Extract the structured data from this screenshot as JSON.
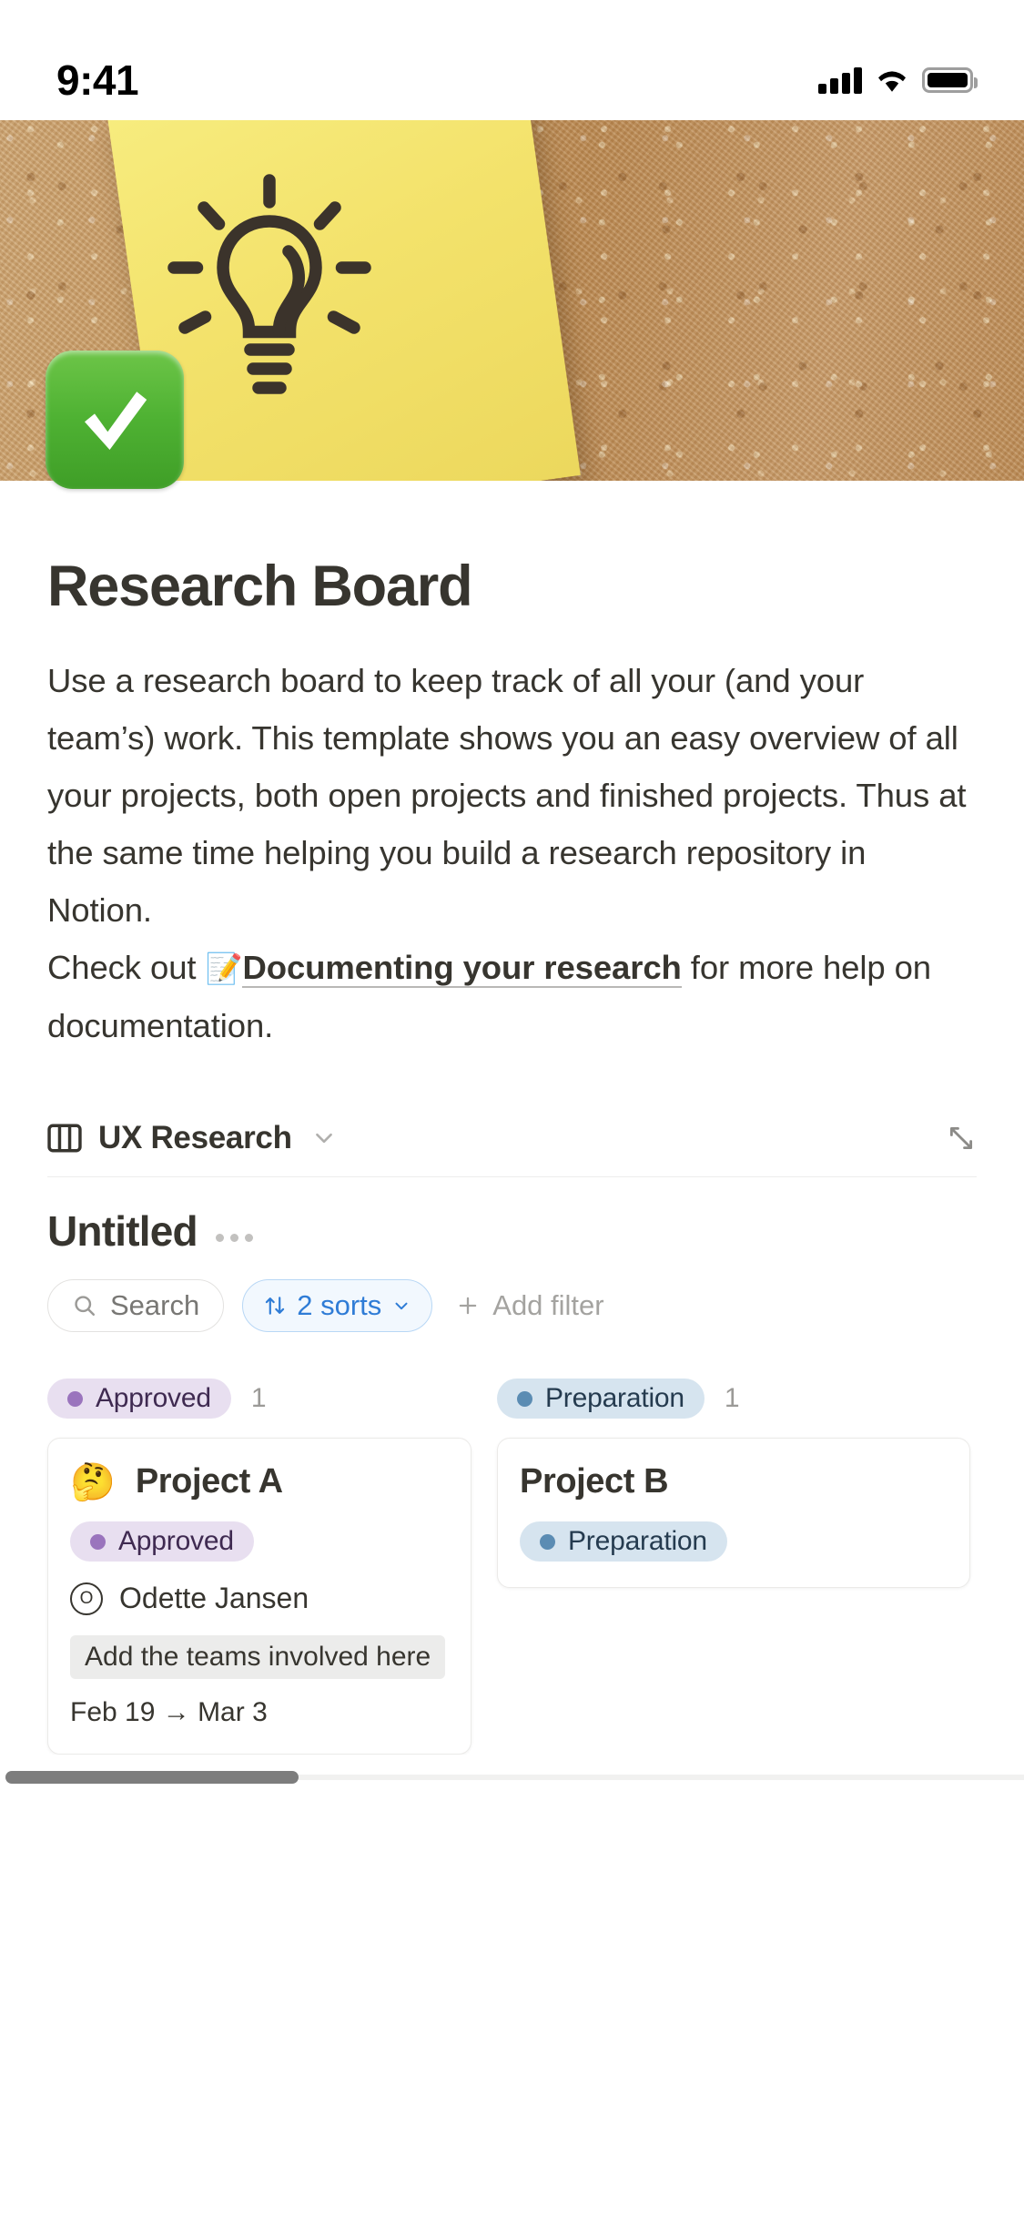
{
  "status_bar": {
    "time": "9:41",
    "signal_icon": "cellular-signal-icon",
    "wifi_icon": "wifi-icon",
    "battery_icon": "battery-icon"
  },
  "cover": {
    "image_description": "cork-board-with-yellow-sticky-note-lightbulb",
    "page_icon": "white-heavy-check-mark",
    "page_icon_color": "#4fb233"
  },
  "page": {
    "title": "Research Board",
    "paragraph_1": "Use a research board to keep track of all your (and your team’s) work. This template shows you an easy overview of all your projects, both open projects and finished projects. Thus at the same time helping you build a research repository in Notion.",
    "paragraph_2_prefix": "Check out ",
    "paragraph_2_emoji": "📝",
    "paragraph_2_link": "Documenting your research",
    "paragraph_2_suffix": " for more help on documentation."
  },
  "database": {
    "view_name": "UX Research",
    "view_icon": "board-view-icon",
    "view_chevron_icon": "chevron-down-icon",
    "expand_icon": "expand-diagonal-icon",
    "title": "Untitled",
    "more_options_icon": "ellipsis-icon"
  },
  "toolbar": {
    "search_label": "Search",
    "search_icon": "search-icon",
    "sorts_label": "2 sorts",
    "sorts_icon": "sort-arrows-icon",
    "sorts_chevron_icon": "chevron-down-icon",
    "sorts_accent_color": "#2f7cd6",
    "add_filter_label": "Add filter",
    "add_filter_icon": "plus-icon"
  },
  "board": {
    "columns": [
      {
        "status": "Approved",
        "status_color": "#9a74bd",
        "status_bg": "#e8dff0",
        "count": "1",
        "cards": [
          {
            "emoji": "🤔",
            "title": "Project A",
            "status": "Approved",
            "person_initial": "O",
            "person": "Odette Jansen",
            "teams_placeholder": "Add the teams involved here",
            "dates": "Feb 19 → Mar 3"
          }
        ]
      },
      {
        "status": "Preparation",
        "status_color": "#5b8cb3",
        "status_bg": "#d6e4ef",
        "count": "1",
        "cards": [
          {
            "emoji": "",
            "title": "Project B",
            "status": "Preparation"
          }
        ]
      }
    ]
  },
  "scrollbar": {
    "orientation": "horizontal",
    "name": "board-horizontal-scrollbar"
  }
}
